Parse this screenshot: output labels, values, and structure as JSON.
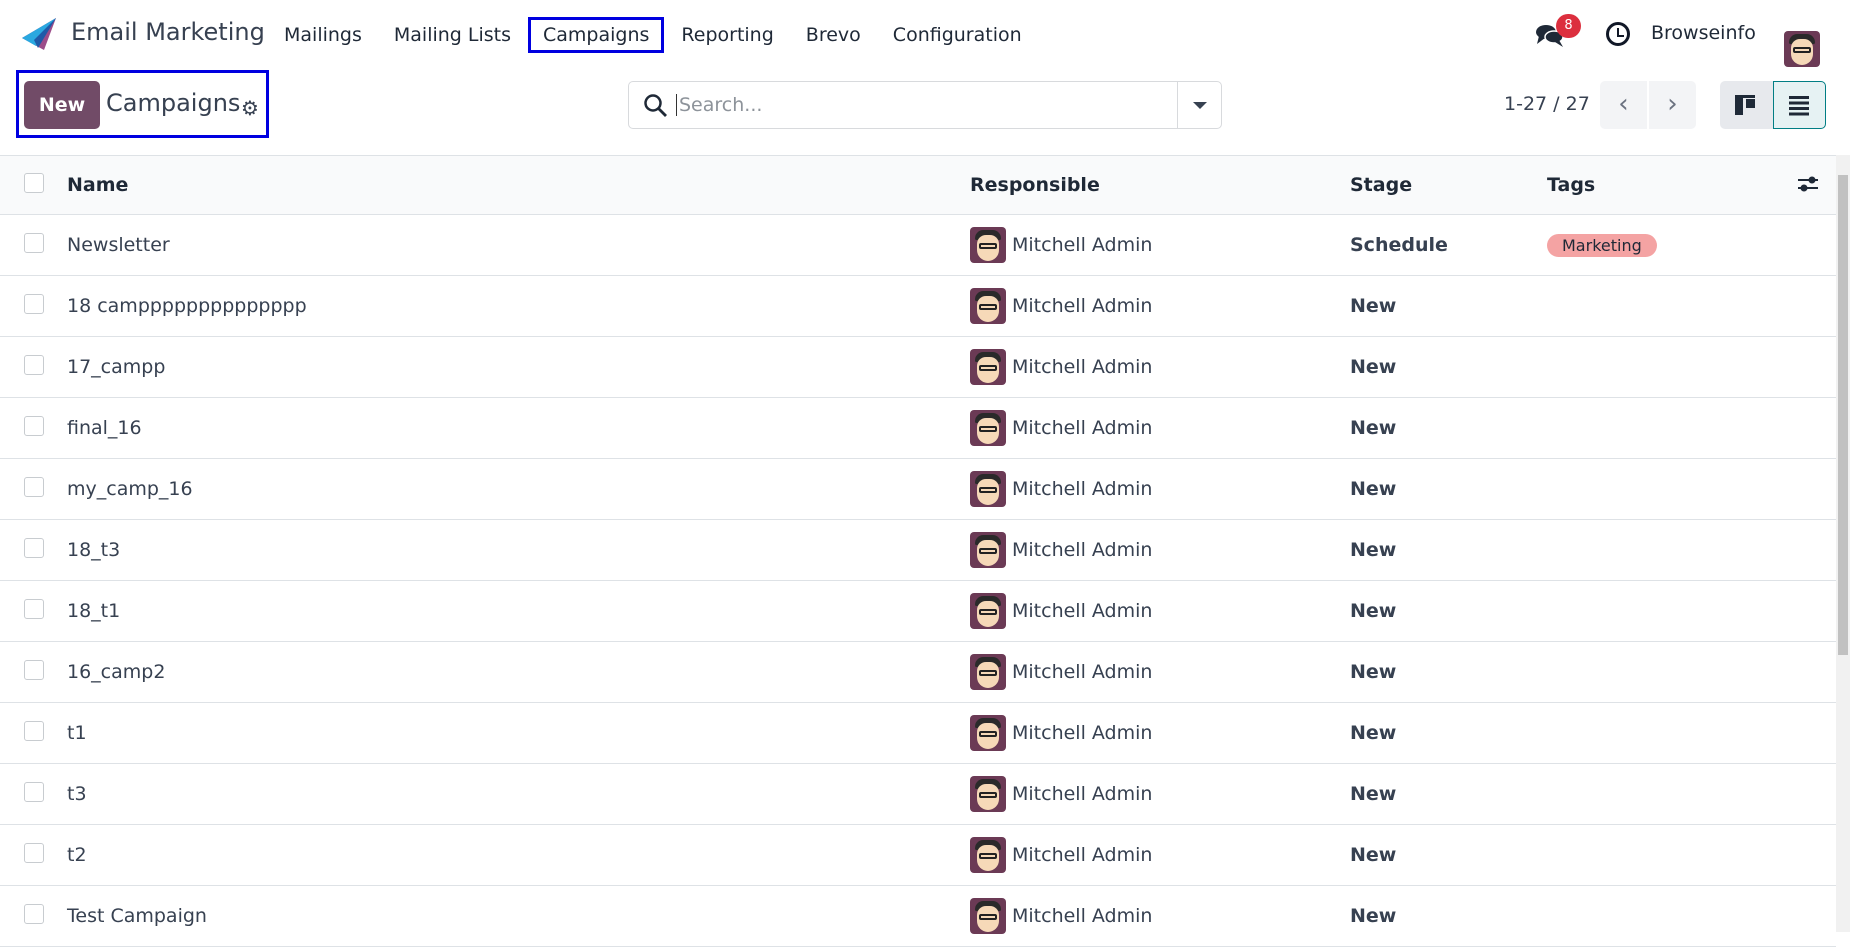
{
  "topbar": {
    "app_name": "Email Marketing",
    "menu": [
      "Mailings",
      "Mailing Lists",
      "Campaigns",
      "Reporting",
      "Brevo",
      "Configuration"
    ],
    "messages_count": "8",
    "company": "Browseinfo"
  },
  "control": {
    "new_label": "New",
    "title": "Campaigns",
    "search_placeholder": "Search...",
    "pager": "1-27 / 27"
  },
  "table": {
    "columns": [
      "Name",
      "Responsible",
      "Stage",
      "Tags"
    ],
    "rows": [
      {
        "name": "Newsletter",
        "responsible": "Mitchell Admin",
        "stage": "Schedule",
        "tag": "Marketing"
      },
      {
        "name": "18 campppppppppppppp",
        "responsible": "Mitchell Admin",
        "stage": "New",
        "tag": ""
      },
      {
        "name": "17_campp",
        "responsible": "Mitchell Admin",
        "stage": "New",
        "tag": ""
      },
      {
        "name": "final_16",
        "responsible": "Mitchell Admin",
        "stage": "New",
        "tag": ""
      },
      {
        "name": "my_camp_16",
        "responsible": "Mitchell Admin",
        "stage": "New",
        "tag": ""
      },
      {
        "name": "18_t3",
        "responsible": "Mitchell Admin",
        "stage": "New",
        "tag": ""
      },
      {
        "name": "18_t1",
        "responsible": "Mitchell Admin",
        "stage": "New",
        "tag": ""
      },
      {
        "name": "16_camp2",
        "responsible": "Mitchell Admin",
        "stage": "New",
        "tag": ""
      },
      {
        "name": "t1",
        "responsible": "Mitchell Admin",
        "stage": "New",
        "tag": ""
      },
      {
        "name": "t3",
        "responsible": "Mitchell Admin",
        "stage": "New",
        "tag": ""
      },
      {
        "name": "t2",
        "responsible": "Mitchell Admin",
        "stage": "New",
        "tag": ""
      },
      {
        "name": "Test Campaign",
        "responsible": "Mitchell Admin",
        "stage": "New",
        "tag": ""
      }
    ]
  },
  "colors": {
    "brand": "#714b67",
    "tag": "#f4a3a3",
    "highlight": "#0000e0",
    "badge": "#dc2f3e"
  }
}
